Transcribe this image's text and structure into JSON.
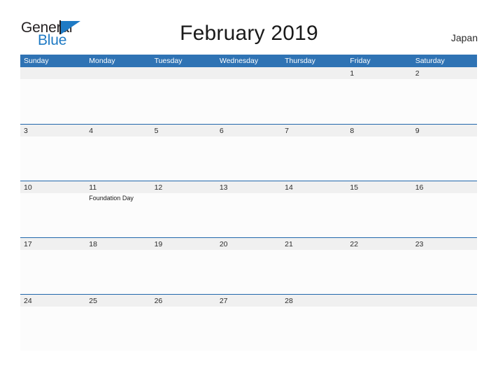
{
  "brand": {
    "name_part1": "General",
    "name_part2": "Blue",
    "flag_icon": "blue-flag-triangle",
    "color_dark": "#231f20",
    "color_blue": "#1f7ac4"
  },
  "header": {
    "title": "February 2019",
    "region": "Japan"
  },
  "theme": {
    "header_blue": "#2f73b4",
    "row_border_blue": "#2167ab",
    "date_band_gray": "#f0f0f0",
    "cell_background": "#fcfcfc",
    "page_background": "#ffffff",
    "text_dark": "#2b2b2b"
  },
  "calendar": {
    "month": "February",
    "year": "2019",
    "weekday_headers": [
      "Sunday",
      "Monday",
      "Tuesday",
      "Wednesday",
      "Thursday",
      "Friday",
      "Saturday"
    ],
    "weeks": [
      [
        {
          "num": "",
          "events": []
        },
        {
          "num": "",
          "events": []
        },
        {
          "num": "",
          "events": []
        },
        {
          "num": "",
          "events": []
        },
        {
          "num": "",
          "events": []
        },
        {
          "num": "1",
          "events": []
        },
        {
          "num": "2",
          "events": []
        }
      ],
      [
        {
          "num": "3",
          "events": []
        },
        {
          "num": "4",
          "events": []
        },
        {
          "num": "5",
          "events": []
        },
        {
          "num": "6",
          "events": []
        },
        {
          "num": "7",
          "events": []
        },
        {
          "num": "8",
          "events": []
        },
        {
          "num": "9",
          "events": []
        }
      ],
      [
        {
          "num": "10",
          "events": []
        },
        {
          "num": "11",
          "events": [
            "Foundation Day"
          ]
        },
        {
          "num": "12",
          "events": []
        },
        {
          "num": "13",
          "events": []
        },
        {
          "num": "14",
          "events": []
        },
        {
          "num": "15",
          "events": []
        },
        {
          "num": "16",
          "events": []
        }
      ],
      [
        {
          "num": "17",
          "events": []
        },
        {
          "num": "18",
          "events": []
        },
        {
          "num": "19",
          "events": []
        },
        {
          "num": "20",
          "events": []
        },
        {
          "num": "21",
          "events": []
        },
        {
          "num": "22",
          "events": []
        },
        {
          "num": "23",
          "events": []
        }
      ],
      [
        {
          "num": "24",
          "events": []
        },
        {
          "num": "25",
          "events": []
        },
        {
          "num": "26",
          "events": []
        },
        {
          "num": "27",
          "events": []
        },
        {
          "num": "28",
          "events": []
        },
        {
          "num": "",
          "events": []
        },
        {
          "num": "",
          "events": []
        }
      ]
    ]
  }
}
